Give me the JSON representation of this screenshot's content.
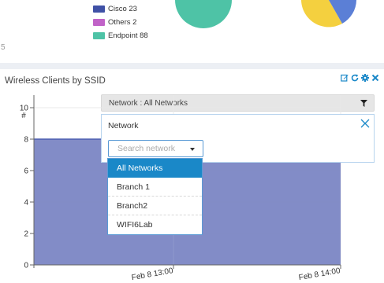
{
  "top_widget": {
    "edge_text": "5",
    "legend": [
      {
        "label": "Cisco 23",
        "color": "#3f51a6"
      },
      {
        "label": "Others 2",
        "color": "#c163c8"
      },
      {
        "label": "Endpoint 88",
        "color": "#4ec3a6"
      }
    ],
    "pie_colors": {
      "teal": "#4ec3a6",
      "yellow": "#f4d03f",
      "blue": "#5b7fd6"
    }
  },
  "widget": {
    "title": "Wireless Clients by SSID",
    "tools": [
      {
        "name": "edit-icon",
        "color": "#1a88c8"
      },
      {
        "name": "refresh-icon",
        "color": "#1a88c8"
      },
      {
        "name": "settings-icon",
        "color": "#1a88c8"
      },
      {
        "name": "close-icon",
        "color": "#1a88c8"
      }
    ],
    "network_bar_label": "Network : All Networks",
    "filter_panel": {
      "label": "Network",
      "search_placeholder": "Search network",
      "options": [
        "All Networks",
        "Branch 1",
        "Branch2",
        "WIFI6Lab"
      ],
      "selected": "All Networks"
    }
  },
  "chart_data": {
    "type": "area",
    "ylabel": "#",
    "y_ticks": [
      "0",
      "2",
      "4",
      "6",
      "8",
      "10"
    ],
    "ylim": [
      0,
      10.8
    ],
    "x_ticks": [
      "Feb 8 13:00",
      "Feb 8 14:00"
    ],
    "series": [
      {
        "values": [
          8,
          8
        ]
      }
    ],
    "fill_color": "#7b86c4",
    "line_color": "#4a5db0",
    "grid": true
  }
}
